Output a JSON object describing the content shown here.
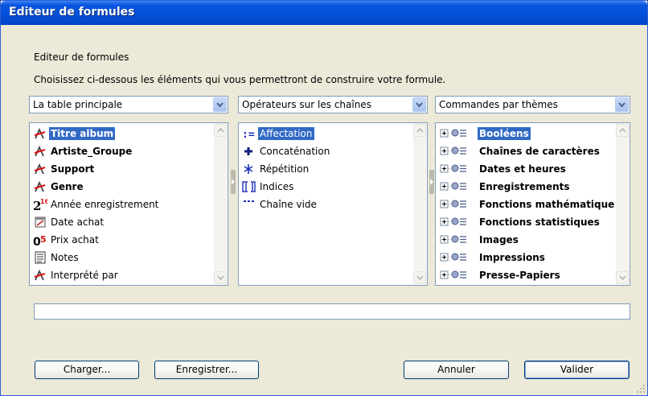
{
  "window": {
    "title": "Editeur de formules"
  },
  "heading": "Editeur de formules",
  "instruction": "Choisissez ci-dessous les éléments qui vous permettront de construire votre formule.",
  "columns": {
    "fields": {
      "combo_value": "La table principale",
      "items": [
        {
          "label": "Titre album",
          "icon": "field-text-icon",
          "bold": true,
          "selected": true
        },
        {
          "label": "Artiste_Groupe",
          "icon": "field-text-icon",
          "bold": true,
          "selected": false
        },
        {
          "label": "Support",
          "icon": "field-text-icon",
          "bold": true,
          "selected": false
        },
        {
          "label": "Genre",
          "icon": "field-text-icon",
          "bold": true,
          "selected": false
        },
        {
          "label": "Année enregistrement",
          "icon": "field-integer-icon",
          "bold": false,
          "selected": false
        },
        {
          "label": "Date achat",
          "icon": "field-date-icon",
          "bold": false,
          "selected": false
        },
        {
          "label": "Prix achat",
          "icon": "field-real-icon",
          "bold": false,
          "selected": false
        },
        {
          "label": "Notes",
          "icon": "field-memo-icon",
          "bold": false,
          "selected": false
        },
        {
          "label": "Interprété par",
          "icon": "field-text-icon",
          "bold": false,
          "selected": false
        }
      ]
    },
    "operators": {
      "combo_value": "Opérateurs sur les chaînes",
      "items": [
        {
          "label": "Affectation",
          "icon": "assign-icon",
          "selected": true
        },
        {
          "label": "Concaténation",
          "icon": "plus-icon",
          "selected": false
        },
        {
          "label": "Répétition",
          "icon": "asterisk-icon",
          "selected": false
        },
        {
          "label": "Indices",
          "icon": "brackets-icon",
          "selected": false
        },
        {
          "label": "Chaîne vide",
          "icon": "empty-string-icon",
          "selected": false
        }
      ]
    },
    "commands": {
      "combo_value": "Commandes par thèmes",
      "items": [
        {
          "label": "Booléens",
          "selected": true
        },
        {
          "label": "Chaînes de caractères",
          "selected": false
        },
        {
          "label": "Dates et heures",
          "selected": false
        },
        {
          "label": "Enregistrements",
          "selected": false
        },
        {
          "label": "Fonctions mathématique",
          "selected": false
        },
        {
          "label": "Fonctions statistiques",
          "selected": false
        },
        {
          "label": "Images",
          "selected": false
        },
        {
          "label": "Impressions",
          "selected": false
        },
        {
          "label": "Presse-Papiers",
          "selected": false
        }
      ]
    }
  },
  "formula": {
    "value": ""
  },
  "buttons": {
    "load": "Charger...",
    "save": "Enregistrer...",
    "cancel": "Annuler",
    "validate": "Valider"
  },
  "colors": {
    "titlebar": "#0451d8",
    "selection": "#316ac5",
    "dialog_bg": "#ece9d8"
  }
}
